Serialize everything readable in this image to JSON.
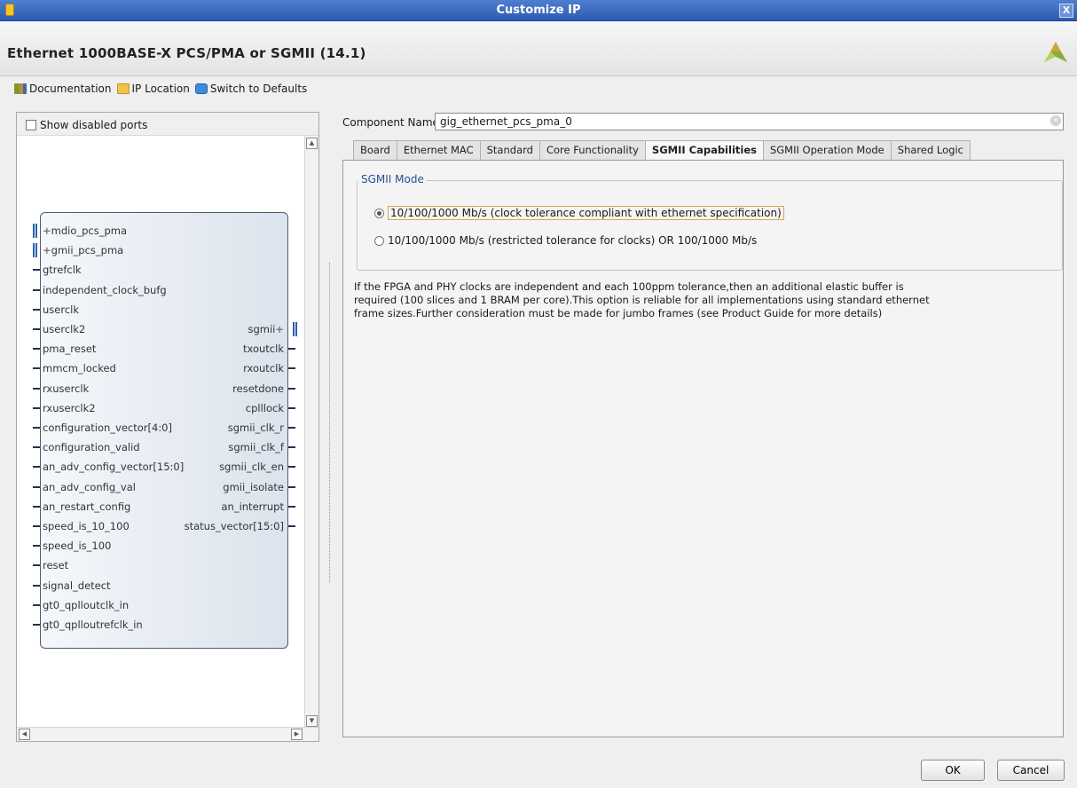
{
  "window": {
    "title": "Customize IP",
    "close_label": "X"
  },
  "header": {
    "ip_title": "Ethernet 1000BASE-X PCS/PMA or SGMII (14.1)"
  },
  "toolbar": {
    "documentation": "Documentation",
    "ip_location": "IP Location",
    "switch_defaults": "Switch to Defaults"
  },
  "left_panel": {
    "show_disabled_ports": "Show disabled ports",
    "show_disabled_checked": false
  },
  "block": {
    "left_pins": [
      {
        "name": "mdio_pcs_pma",
        "kind": "bus-interface"
      },
      {
        "name": "gmii_pcs_pma",
        "kind": "bus-interface"
      },
      {
        "name": "gtrefclk",
        "kind": "wire"
      },
      {
        "name": "independent_clock_bufg",
        "kind": "wire"
      },
      {
        "name": "userclk",
        "kind": "wire"
      },
      {
        "name": "userclk2",
        "kind": "wire"
      },
      {
        "name": "pma_reset",
        "kind": "wire"
      },
      {
        "name": "mmcm_locked",
        "kind": "wire"
      },
      {
        "name": "rxuserclk",
        "kind": "wire"
      },
      {
        "name": "rxuserclk2",
        "kind": "wire"
      },
      {
        "name": "configuration_vector[4:0]",
        "kind": "wire"
      },
      {
        "name": "configuration_valid",
        "kind": "wire"
      },
      {
        "name": "an_adv_config_vector[15:0]",
        "kind": "wire"
      },
      {
        "name": "an_adv_config_val",
        "kind": "wire"
      },
      {
        "name": "an_restart_config",
        "kind": "wire"
      },
      {
        "name": "speed_is_10_100",
        "kind": "wire"
      },
      {
        "name": "speed_is_100",
        "kind": "wire"
      },
      {
        "name": "reset",
        "kind": "wire"
      },
      {
        "name": "signal_detect",
        "kind": "wire"
      },
      {
        "name": "gt0_qplloutclk_in",
        "kind": "wire"
      },
      {
        "name": "gt0_qplloutrefclk_in",
        "kind": "wire"
      }
    ],
    "right_pins": [
      {
        "name": "sgmii",
        "kind": "bus-interface"
      },
      {
        "name": "txoutclk",
        "kind": "wire"
      },
      {
        "name": "rxoutclk",
        "kind": "wire"
      },
      {
        "name": "resetdone",
        "kind": "wire"
      },
      {
        "name": "cplllock",
        "kind": "wire"
      },
      {
        "name": "sgmii_clk_r",
        "kind": "wire"
      },
      {
        "name": "sgmii_clk_f",
        "kind": "wire"
      },
      {
        "name": "sgmii_clk_en",
        "kind": "wire"
      },
      {
        "name": "gmii_isolate",
        "kind": "wire"
      },
      {
        "name": "an_interrupt",
        "kind": "wire"
      },
      {
        "name": "status_vector[15:0]",
        "kind": "wire"
      }
    ]
  },
  "component": {
    "label": "Component Name",
    "value": "gig_ethernet_pcs_pma_0"
  },
  "tabs": [
    {
      "label": "Board",
      "active": false
    },
    {
      "label": "Ethernet MAC",
      "active": false
    },
    {
      "label": "Standard",
      "active": false
    },
    {
      "label": "Core Functionality",
      "active": false
    },
    {
      "label": "SGMII Capabilities",
      "active": true
    },
    {
      "label": "SGMII Operation Mode",
      "active": false
    },
    {
      "label": "Shared Logic",
      "active": false
    }
  ],
  "sgmii": {
    "group_title": "SGMII Mode",
    "options": [
      {
        "label": "10/100/1000 Mb/s (clock tolerance compliant with ethernet specification)",
        "selected": true
      },
      {
        "label": "10/100/1000 Mb/s (restricted tolerance for clocks) OR 100/1000 Mb/s",
        "selected": false
      }
    ],
    "description": [
      "If the FPGA and PHY clocks are independent and each 100ppm tolerance,then an additional elastic buffer is",
      "required (100 slices and 1 BRAM per core).This option is reliable for all implementations using standard ethernet",
      "frame sizes.Further consideration must be made for jumbo frames (see Product Guide for more details)"
    ]
  },
  "buttons": {
    "ok": "OK",
    "cancel": "Cancel"
  },
  "colors": {
    "titlebar": "#2c5ab0",
    "bus_pin": "#2a5fb0",
    "group_title": "#2b4f8c"
  }
}
